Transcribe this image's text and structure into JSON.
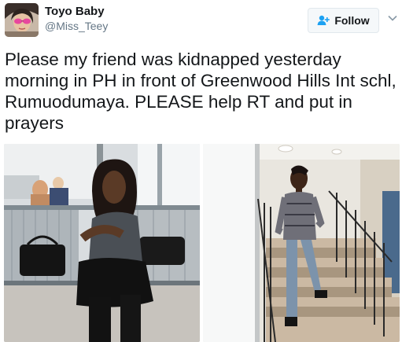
{
  "user": {
    "display_name": "Toyo Baby",
    "handle": "@Miss_Teey"
  },
  "actions": {
    "follow_label": "Follow",
    "follow_icon": "add-user-icon",
    "menu_icon": "chevron-down-icon"
  },
  "tweet": {
    "text": "Please my friend was kidnapped yesterday morning in PH in front of Greenwood Hills Int schl, Rumuodumaya. PLEASE help RT and put in prayers"
  },
  "colors": {
    "text_primary": "#14171a",
    "text_secondary": "#657786",
    "button_bg": "#f5f8fa",
    "button_border": "#e1e8ed",
    "follow_icon_color": "#1da1f2"
  }
}
